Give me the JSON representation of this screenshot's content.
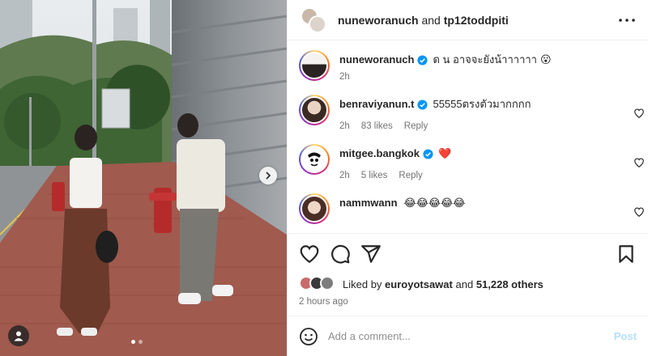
{
  "header": {
    "user1": "nuneworanuch",
    "connector": "and",
    "user2": "tp12toddpiti"
  },
  "comments": [
    {
      "username": "nuneworanuch",
      "verified": true,
      "text": "ด น อาจจะยังน้าาาาาา",
      "emoji": "😮",
      "time": "2h",
      "likes": "",
      "reply": ""
    },
    {
      "username": "benraviyanun.t",
      "verified": true,
      "text": "55555ตรงตัวมากกกก",
      "time": "2h",
      "likes": "83 likes",
      "reply": "Reply"
    },
    {
      "username": "mitgee.bangkok",
      "verified": true,
      "text": "❤️",
      "time": "2h",
      "likes": "5 likes",
      "reply": "Reply"
    },
    {
      "username": "nammwann",
      "verified": false,
      "text": "😂😂😂😂😂"
    }
  ],
  "likes": {
    "prefix": "Liked by",
    "user": "euroyotsawat",
    "connector": "and",
    "others": "51,228 others"
  },
  "time_ago": "2 hours ago",
  "add_comment": {
    "placeholder": "Add a comment...",
    "post_label": "Post"
  },
  "colors": {
    "verified": "#0095f6",
    "post_disabled": "#b2dffc",
    "meta_text": "#737373"
  },
  "icons": [
    "more-icon",
    "heart-icon",
    "comment-icon",
    "share-icon",
    "save-icon",
    "emoji-icon",
    "next-arrow-icon",
    "user-tag-icon"
  ]
}
